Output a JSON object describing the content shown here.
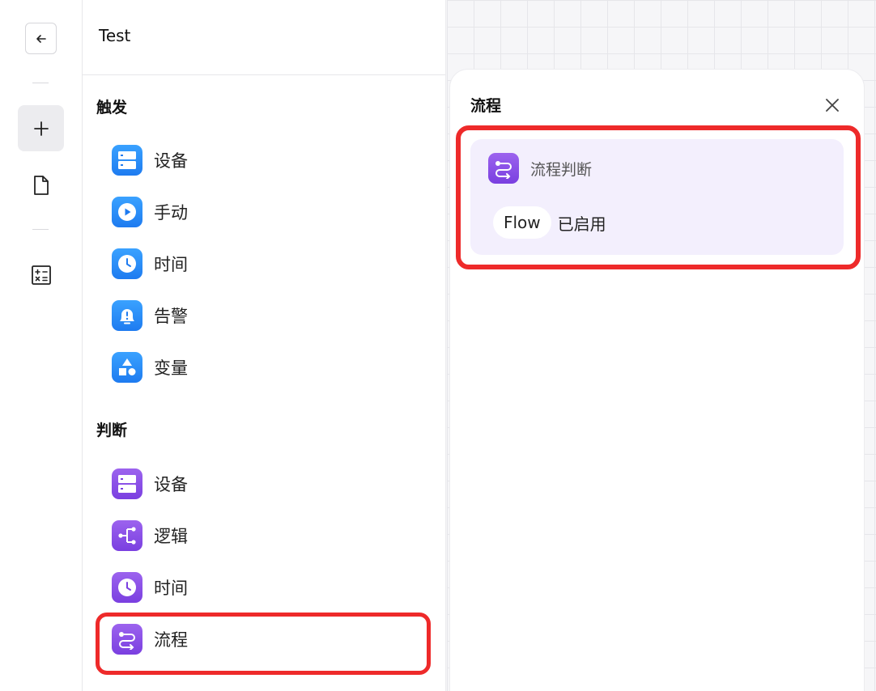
{
  "rail": {
    "back": "back-arrow-icon",
    "add": "plus-icon",
    "doc": "document-icon",
    "calc": "calculator-icon"
  },
  "menu": {
    "title": "Test",
    "trigger_section": "触发",
    "trigger_items": [
      {
        "label": "设备",
        "icon": "server-icon"
      },
      {
        "label": "手动",
        "icon": "play-icon"
      },
      {
        "label": "时间",
        "icon": "clock-icon"
      },
      {
        "label": "告警",
        "icon": "alarm-icon"
      },
      {
        "label": "变量",
        "icon": "shapes-icon"
      }
    ],
    "condition_section": "判断",
    "condition_items": [
      {
        "label": "设备",
        "icon": "server-icon"
      },
      {
        "label": "逻辑",
        "icon": "branch-icon"
      },
      {
        "label": "时间",
        "icon": "clock-icon"
      },
      {
        "label": "流程",
        "icon": "flow-icon"
      }
    ]
  },
  "detail": {
    "title": "流程",
    "close_icon": "close-icon",
    "card": {
      "label": "流程判断",
      "flow_name": "Flow",
      "status": "已启用"
    }
  },
  "colors": {
    "trigger_blue": "#1e7bf0",
    "condition_purple": "#7a3fe0",
    "highlight_red": "#ee2a2a",
    "card_bg": "#f3effd"
  }
}
